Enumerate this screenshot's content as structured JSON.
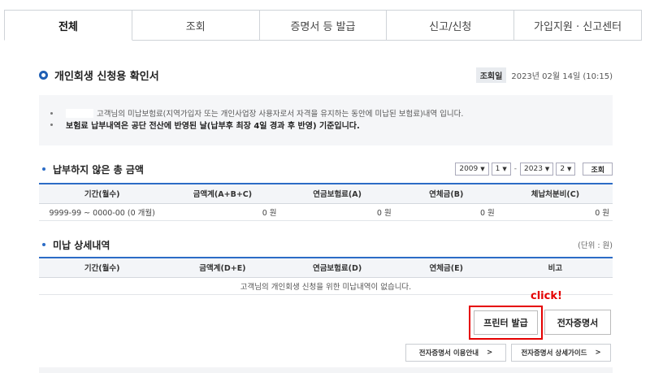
{
  "tabs": [
    "전체",
    "조회",
    "증명서 등 발급",
    "신고/신청",
    "가입지원 · 신고센터"
  ],
  "page": {
    "title": "개인회생 신청용 확인서",
    "query_badge": "조회일",
    "query_date": "2023년 02월 14일 (10:15)"
  },
  "notice": {
    "line1": "고객님의 미납보험료(지역가입자 또는 개인사업장 사용자로서 자격을 유지하는 동안에 미납된 보험료)내역 입니다.",
    "line2": "보험료 납부내역은 공단 전산에 반영된 날(납부후 최장 4일 경과 후 반영) 기준입니다."
  },
  "unpaid_total": {
    "title": "납부하지 않은 총 금액",
    "filters": {
      "start_year": "2009",
      "start_month": "1",
      "separator": "-",
      "end_year": "2023",
      "end_month": "2",
      "query_button": "조회"
    },
    "headers": [
      "기간(월수)",
      "금액계(A+B+C)",
      "연금보험료(A)",
      "연체금(B)",
      "체납처분비(C)"
    ],
    "row": [
      "9999-99 ~ 0000-00 (0 개월)",
      "0 원",
      "0 원",
      "0 원",
      "0 원"
    ]
  },
  "unpaid_detail": {
    "title": "미납 상세내역",
    "unit": "(단위 : 원)",
    "headers": [
      "기간(월수)",
      "금액계(D+E)",
      "연금보험료(D)",
      "연체금(E)",
      "비고"
    ],
    "empty_message": "고객님의 개인회생 신청을 위한 미납내역이 없습니다."
  },
  "actions": {
    "click_label": "click!",
    "print_button": "프린터 발급",
    "esign_button": "전자증명서",
    "guide_button": "전자증명서 이용안내",
    "detail_guide_button": "전자증명서 상세가이드",
    "arrow": ">"
  }
}
